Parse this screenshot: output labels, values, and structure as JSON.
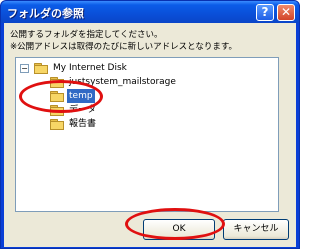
{
  "window": {
    "title": "フォルダの参照",
    "help_button": "?",
    "close_button": "✕"
  },
  "message": {
    "line1": "公開するフォルダを指定してください。",
    "line2": "※公開アドレスは取得のたびに新しいアドレスとなります。"
  },
  "tree": {
    "root": {
      "label": "My Internet Disk",
      "expander": "−"
    },
    "items": [
      {
        "label": "justsystem_mailstorage",
        "selected": false
      },
      {
        "label": "temp",
        "selected": true
      },
      {
        "label": "データ",
        "selected": false
      },
      {
        "label": "報告書",
        "selected": false
      }
    ]
  },
  "buttons": {
    "ok": "OK",
    "cancel": "キャンセル"
  },
  "colors": {
    "selection": "#316ac5",
    "annotation": "#e01010",
    "dialog_face": "#ece9d8"
  }
}
